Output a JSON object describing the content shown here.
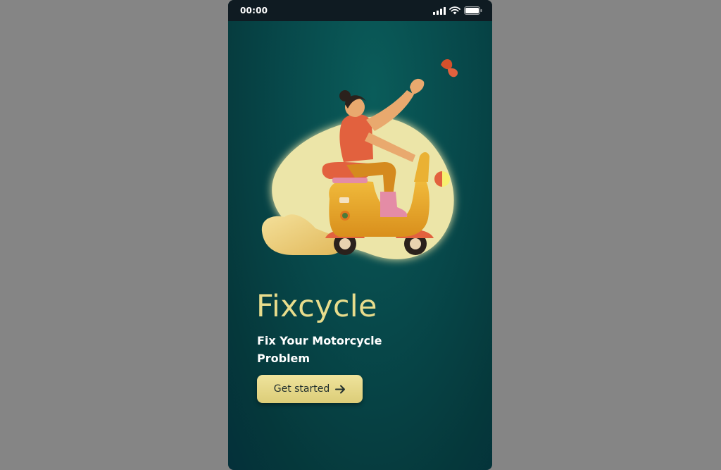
{
  "status_bar": {
    "time": "00:00",
    "icons": [
      "cellular-signal-icon",
      "wifi-icon",
      "battery-icon"
    ]
  },
  "hero": {
    "illustration": "person-riding-scooter-illustration"
  },
  "app_title": "Fixcycle",
  "tagline": "Fix Your Motorcycle Problem",
  "cta": {
    "label": "Get started",
    "icon": "arrow-right-icon"
  },
  "colors": {
    "background_top": "#0a5c5a",
    "background_bottom": "#04303a",
    "status_bar": "#0f1b22",
    "accent": "#e8dc8c",
    "button": "#e6d98a",
    "blob": "#ece5a8",
    "scooter": "#e9a92a",
    "shirt": "#e2613e"
  }
}
